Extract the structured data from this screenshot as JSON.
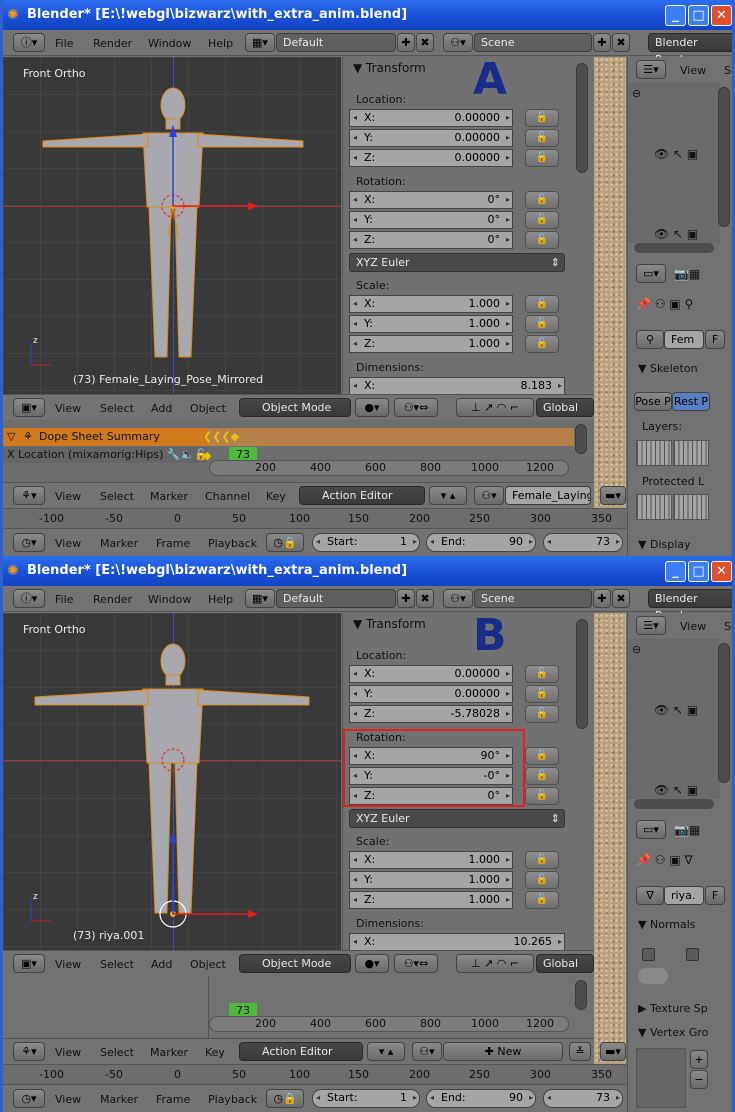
{
  "window": {
    "title": "Blender* [E:\\!webgl\\bizwarz\\with_extra_anim.blend]",
    "minimize": "_",
    "maximize": "□",
    "close": "✕"
  },
  "menu": {
    "file": "File",
    "render": "Render",
    "window": "Window",
    "help": "Help",
    "layout": "Default",
    "scene": "Scene",
    "engine": "Blender Render"
  },
  "view3d": {
    "ortho_label": "Front Ortho",
    "axis_z": "z",
    "axis_x": "x",
    "menus": {
      "view": "View",
      "select": "Select",
      "add": "Add",
      "object": "Object"
    },
    "mode": "Object Mode",
    "orientation": "Global"
  },
  "transform": {
    "header": "Transform",
    "location_label": "Location:",
    "rotation_label": "Rotation:",
    "scale_label": "Scale:",
    "dimensions_label": "Dimensions:",
    "euler": "XYZ Euler",
    "x": "X:",
    "y": "Y:",
    "z": "Z:"
  },
  "shotA": {
    "letter": "A",
    "object_label": "(73) Female_Laying_Pose_Mirrored",
    "location": [
      "0.00000",
      "0.00000",
      "0.00000"
    ],
    "rotation": [
      "0°",
      "0°",
      "0°"
    ],
    "scale": [
      "1.000",
      "1.000",
      "1.000"
    ],
    "dim_x": "8.183",
    "dope_summary": "Dope Sheet Summary",
    "dope_channel": "X Location (mixamorig:Hips)",
    "frame": "73",
    "ticks": [
      "200",
      "400",
      "600",
      "800",
      "1000",
      "1200"
    ],
    "action_menus": {
      "view": "View",
      "select": "Select",
      "marker": "Marker",
      "channel": "Channel",
      "key": "Key"
    },
    "action_editor": "Action Editor",
    "action_name": "Female_Laying_",
    "props": {
      "name_field": "Fem",
      "f_btn": "F",
      "skeleton": "Skeleton",
      "pose_btn": "Pose P",
      "rest_btn": "Rest P",
      "layers": "Layers:",
      "protected": "Protected L",
      "display": "Display"
    },
    "view_tab": "View",
    "se_tab": "Se"
  },
  "shotB": {
    "letter": "B",
    "object_label": "(73) riya.001",
    "location": [
      "0.00000",
      "0.00000",
      "-5.78028"
    ],
    "rotation": [
      "90°",
      "-0°",
      "0°"
    ],
    "scale": [
      "1.000",
      "1.000",
      "1.000"
    ],
    "dim_x": "10.265",
    "frame": "73",
    "ticks": [
      "200",
      "400",
      "600",
      "800",
      "1000",
      "1200"
    ],
    "action_menus": {
      "view": "View",
      "select": "Select",
      "marker": "Marker",
      "key": "Key"
    },
    "action_editor": "Action Editor",
    "new_btn": "New",
    "props": {
      "name_field": "riya.",
      "f_btn": "F",
      "normals": "Normals",
      "texture": "Texture Sp",
      "vertex": "Vertex Gro"
    },
    "view_tab": "View",
    "se_tab": "Se"
  },
  "timeline": {
    "ticks": [
      "-100",
      "-50",
      "0",
      "50",
      "100",
      "150",
      "200",
      "250",
      "300",
      "350"
    ],
    "menus": {
      "view": "View",
      "marker": "Marker",
      "frame": "Frame",
      "playback": "Playback"
    },
    "start_label": "Start:",
    "start": "1",
    "end_label": "End:",
    "end": "90",
    "current": "73"
  },
  "colors": {
    "title_blue": "#1850d6",
    "dope_orange": "#d07a1e",
    "frame_green": "#4fb93a",
    "highlight_red": "#e02020",
    "letter_blue": "#1a2c8a",
    "rest_blue": "#5680c2"
  }
}
